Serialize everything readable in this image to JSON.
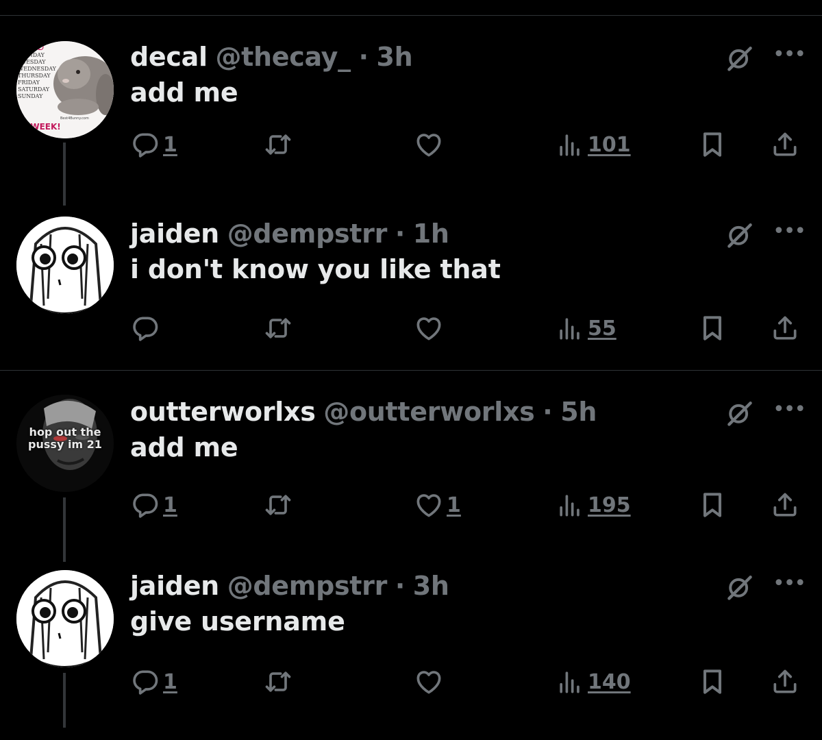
{
  "tweets": [
    {
      "name": "decal",
      "handle": "@thecay_",
      "separator": "·",
      "time": "3h",
      "text": "add me",
      "avatar_caption": [
        "YOU",
        "MONDAY",
        "TUESDAY",
        "WEDNESDAY",
        "THURSDAY",
        "FRIDAY",
        "SATURDAY",
        "SUNDAY",
        "Best4Bunny.com",
        "T WEEK!"
      ],
      "replies": "1",
      "retweets": "",
      "likes": "",
      "views": "101"
    },
    {
      "name": "jaiden",
      "handle": "@dempstrr",
      "separator": "·",
      "time": "1h",
      "text": "i don't know you like that",
      "replies": "",
      "retweets": "",
      "likes": "",
      "views": "55"
    },
    {
      "name": "outterworlxs",
      "handle": "@outterworlxs",
      "separator": "·",
      "time": "5h",
      "text": "add me",
      "avatar_caption": [
        "hop out the",
        "pussy im 21"
      ],
      "replies": "1",
      "retweets": "",
      "likes": "1",
      "views": "195"
    },
    {
      "name": "jaiden",
      "handle": "@dempstrr",
      "separator": "·",
      "time": "3h",
      "text": "give username",
      "replies": "1",
      "retweets": "",
      "likes": "",
      "views": "140"
    }
  ],
  "icons": {
    "reply": "reply-icon",
    "retweet": "retweet-icon",
    "like": "heart-icon",
    "views": "views-icon",
    "bookmark": "bookmark-icon",
    "share": "share-icon",
    "grok": "grok-icon",
    "more": "more-icon"
  },
  "colors": {
    "background": "#000000",
    "primary_text": "#e7e9ea",
    "secondary_text": "#71767b",
    "divider": "#2f3336"
  }
}
